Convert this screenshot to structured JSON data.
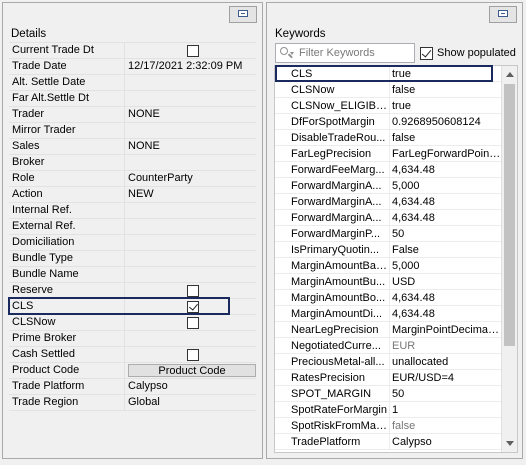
{
  "details": {
    "title": "Details",
    "rows": [
      {
        "label": "Current Trade Dt",
        "value": "",
        "type": "checkbox",
        "checked": false
      },
      {
        "label": "Trade Date",
        "value": "12/17/2021 2:32:09 PM",
        "type": "text"
      },
      {
        "label": "Alt. Settle Date",
        "value": "",
        "type": "text"
      },
      {
        "label": "Far Alt.Settle Dt",
        "value": "",
        "type": "text"
      },
      {
        "label": "Trader",
        "value": "NONE",
        "type": "text"
      },
      {
        "label": "Mirror Trader",
        "value": "",
        "type": "text"
      },
      {
        "label": "Sales",
        "value": "NONE",
        "type": "text"
      },
      {
        "label": "Broker",
        "value": "",
        "type": "text"
      },
      {
        "label": "Role",
        "value": "CounterParty",
        "type": "text"
      },
      {
        "label": "Action",
        "value": "NEW",
        "type": "text"
      },
      {
        "label": "Internal Ref.",
        "value": "",
        "type": "text"
      },
      {
        "label": "External Ref.",
        "value": "",
        "type": "text"
      },
      {
        "label": "Domiciliation",
        "value": "",
        "type": "text"
      },
      {
        "label": "Bundle Type",
        "value": "",
        "type": "text"
      },
      {
        "label": "Bundle Name",
        "value": "",
        "type": "text"
      },
      {
        "label": "Reserve",
        "value": "",
        "type": "checkbox",
        "checked": false
      },
      {
        "label": "CLS",
        "value": "",
        "type": "checkbox",
        "checked": true
      },
      {
        "label": "CLSNow",
        "value": "",
        "type": "checkbox",
        "checked": false
      },
      {
        "label": "Prime Broker",
        "value": "",
        "type": "text"
      },
      {
        "label": "Cash Settled",
        "value": "",
        "type": "checkbox",
        "checked": false
      },
      {
        "label": "Product Code",
        "value": "Product Code",
        "type": "button"
      },
      {
        "label": "Trade Platform",
        "value": "Calypso",
        "type": "text"
      },
      {
        "label": "Trade Region",
        "value": "Global",
        "type": "text"
      }
    ]
  },
  "keywords": {
    "title": "Keywords",
    "filter_placeholder": "Filter Keywords",
    "show_populated_label": "Show populated",
    "show_populated_checked": true,
    "rows": [
      {
        "name": "CLS",
        "value": "true"
      },
      {
        "name": "CLSNow",
        "value": "false"
      },
      {
        "name": "CLSNow_ELIGIBLE",
        "value": "true"
      },
      {
        "name": "DfForSpotMargin",
        "value": "0.9268950608124"
      },
      {
        "name": "DisableTradeRou...",
        "value": "false"
      },
      {
        "name": "FarLegPrecision",
        "value": "FarLegForwardPoint..."
      },
      {
        "name": "ForwardFeeMarg...",
        "value": "4,634.48"
      },
      {
        "name": "ForwardMarginA...",
        "value": "5,000"
      },
      {
        "name": "ForwardMarginA...",
        "value": "4,634.48"
      },
      {
        "name": "ForwardMarginA...",
        "value": "4,634.48"
      },
      {
        "name": "ForwardMarginP...",
        "value": "50"
      },
      {
        "name": "IsPrimaryQuotin...",
        "value": "False"
      },
      {
        "name": "MarginAmountBasis",
        "value": "5,000"
      },
      {
        "name": "MarginAmountBu...",
        "value": "USD"
      },
      {
        "name": "MarginAmountBo...",
        "value": "4,634.48"
      },
      {
        "name": "MarginAmountDi...",
        "value": "4,634.48"
      },
      {
        "name": "NearLegPrecision",
        "value": "MarginPointDecimals..."
      },
      {
        "name": "NegotiatedCurre...",
        "value": "EUR",
        "dim": true
      },
      {
        "name": "PreciousMetal-all...",
        "value": "unallocated"
      },
      {
        "name": "RatesPrecision",
        "value": "EUR/USD=4"
      },
      {
        "name": "SPOT_MARGIN",
        "value": "50"
      },
      {
        "name": "SpotRateForMargin",
        "value": "1"
      },
      {
        "name": "SpotRiskFromMai...",
        "value": "false",
        "dim": true
      },
      {
        "name": "TradePlatform",
        "value": "Calypso"
      }
    ]
  },
  "colors": {
    "highlight": "#1a2a5e",
    "background": "#f0f0f0"
  },
  "icons": {
    "panel_button": "restore-window-icon",
    "filter": "search-icon"
  }
}
